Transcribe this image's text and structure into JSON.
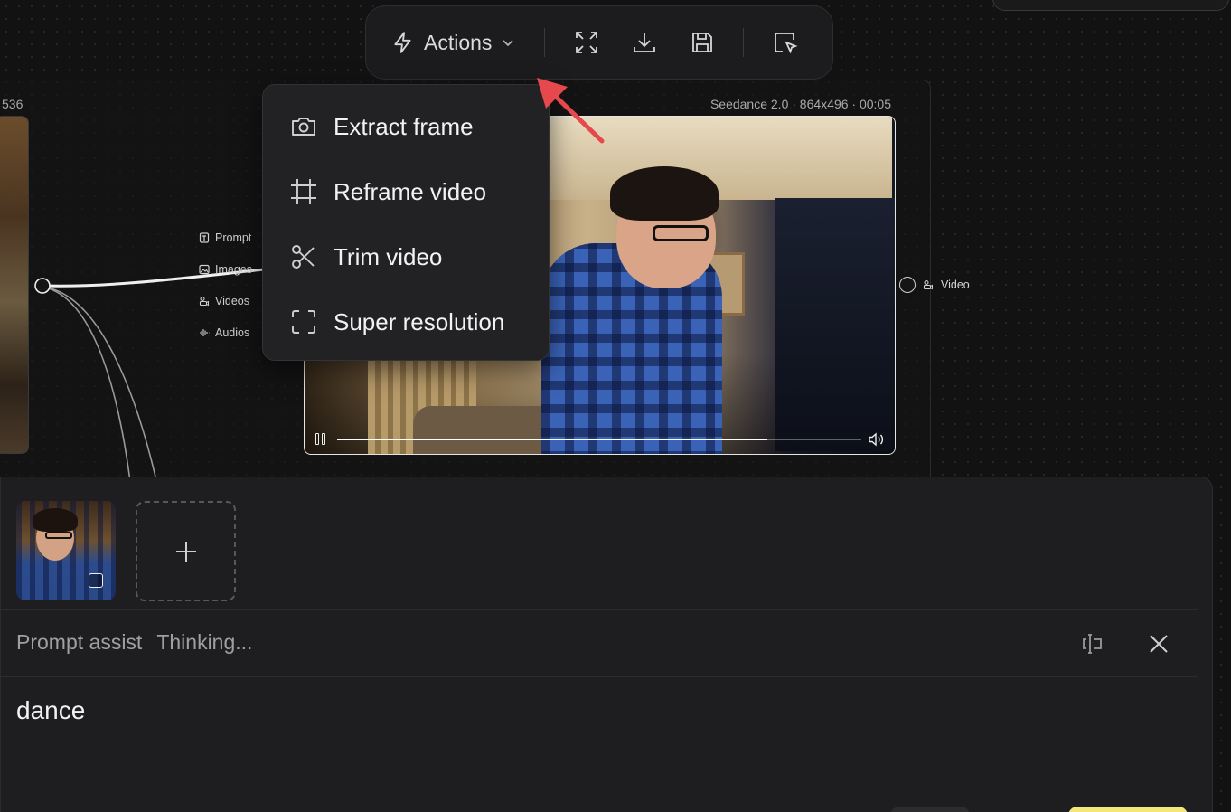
{
  "canvas": {
    "left_node_number": "536",
    "input_ports": [
      {
        "label": "Prompt",
        "icon": "prompt-icon"
      },
      {
        "label": "Images",
        "icon": "image-icon"
      },
      {
        "label": "Videos",
        "icon": "video-icon"
      },
      {
        "label": "Audios",
        "icon": "audio-icon"
      }
    ],
    "video_node": {
      "meta": "Seedance 2.0 · 864x496 · 00:05",
      "progress": 0.82,
      "output_port_label": "Video"
    }
  },
  "toolbar": {
    "actions_label": "Actions",
    "icons": [
      "expand-icon",
      "download-icon",
      "save-icon",
      "select-cursor-icon"
    ]
  },
  "actions_menu": {
    "items": [
      {
        "label": "Extract frame",
        "icon": "camera-icon"
      },
      {
        "label": "Reframe video",
        "icon": "crop-icon"
      },
      {
        "label": "Trim video",
        "icon": "scissors-icon"
      },
      {
        "label": "Super resolution",
        "icon": "focus-frame-icon"
      }
    ]
  },
  "prompt_panel": {
    "assist_label": "Prompt assist",
    "assist_status": "Thinking...",
    "prompt_text": "dance"
  },
  "colors": {
    "accent_arrow": "#e5484d",
    "panel_bg": "#1e1e20",
    "menu_bg": "#222224"
  }
}
